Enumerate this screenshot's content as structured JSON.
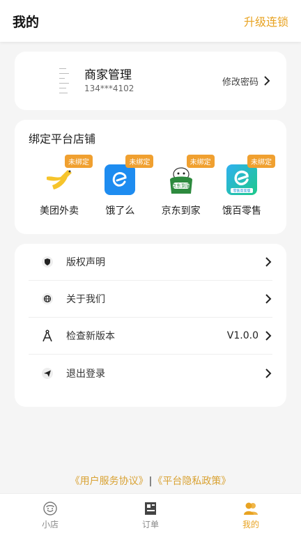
{
  "header": {
    "title": "我的",
    "upgrade_label": "升级连锁"
  },
  "profile": {
    "name": "商家管理",
    "phone": "134***4102",
    "change_password_label": "修改密码"
  },
  "platforms": {
    "section_title": "绑定平台店铺",
    "items": [
      {
        "label": "美团外卖",
        "badge": "未绑定",
        "icon": "meituan-icon"
      },
      {
        "label": "饿了么",
        "badge": "未绑定",
        "icon": "eleme-icon"
      },
      {
        "label": "京东到家",
        "badge": "未绑定",
        "icon": "jddj-icon",
        "icon_text": "京东到家"
      },
      {
        "label": "饿百零售",
        "badge": "未绑定",
        "icon": "ebai-icon",
        "icon_text": "零售商家版"
      }
    ]
  },
  "menu": {
    "items": [
      {
        "label": "版权声明",
        "icon": "shield-icon"
      },
      {
        "label": "关于我们",
        "icon": "globe-icon"
      },
      {
        "label": "检查新版本",
        "icon": "compass-icon",
        "value": "V1.0.0"
      },
      {
        "label": "退出登录",
        "icon": "send-icon"
      }
    ]
  },
  "footer": {
    "user_agreement": "《用户服务协议》",
    "separator": "|",
    "privacy_policy": "《平台隐私政策》"
  },
  "tabbar": {
    "items": [
      {
        "label": "小店",
        "icon": "store-icon",
        "active": false
      },
      {
        "label": "订单",
        "icon": "order-icon",
        "active": false
      },
      {
        "label": "我的",
        "icon": "profile-icon",
        "active": true
      }
    ]
  },
  "colors": {
    "accent": "#e8a322",
    "badge": "#f0a030",
    "background": "#f5f5f5"
  }
}
